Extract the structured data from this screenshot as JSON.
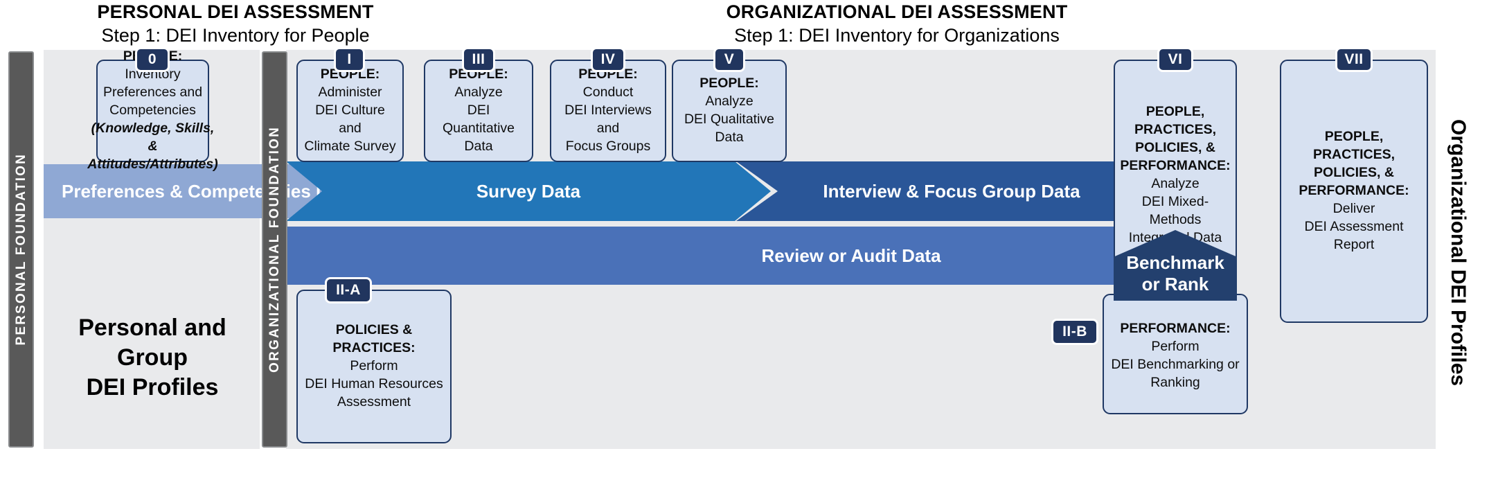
{
  "headers": {
    "personal": {
      "line1": "PERSONAL DEI ASSESSMENT",
      "line2": "Step 1: DEI Inventory for People"
    },
    "organizational": {
      "line1": "ORGANIZATIONAL DEI ASSESSMENT",
      "line2": "Step 1: DEI Inventory for Organizations"
    }
  },
  "foundations": {
    "personal": "PERSONAL FOUNDATION",
    "organizational": "ORGANIZATIONAL FOUNDATION"
  },
  "right_label": "Organizational DEI Profiles",
  "personal_summary": "Personal and\nGroup\nDEI Profiles",
  "cards": [
    {
      "badge": "0",
      "heading": "PEOPLE:",
      "lines": [
        "Inventory",
        "Preferences and",
        "Competencies"
      ],
      "italic_lines": [
        "(Knowledge, Skills, &",
        "Attitudes/Attributes)"
      ]
    },
    {
      "badge": "I",
      "heading": "PEOPLE:",
      "lines": [
        "Administer",
        "DEI Culture and",
        "Climate Survey"
      ],
      "italic_lines": []
    },
    {
      "badge": "III",
      "heading": "PEOPLE:",
      "lines": [
        "Analyze",
        "DEI Quantitative",
        "Data"
      ],
      "italic_lines": []
    },
    {
      "badge": "IV",
      "heading": "PEOPLE:",
      "lines": [
        "Conduct",
        "DEI Interviews and",
        "Focus Groups"
      ],
      "italic_lines": []
    },
    {
      "badge": "V",
      "heading": "PEOPLE:",
      "lines": [
        "Analyze",
        "DEI Qualitative",
        "Data"
      ],
      "italic_lines": []
    },
    {
      "badge": "VI",
      "heading": "PEOPLE,\nPRACTICES,\nPOLICIES, &\nPERFORMANCE:",
      "lines": [
        "Analyze",
        "DEI Mixed-Methods",
        "Integrated Data"
      ],
      "italic_lines": []
    },
    {
      "badge": "VII",
      "heading": "PEOPLE,\nPRACTICES,\nPOLICIES, &\nPERFORMANCE:",
      "lines": [
        "Deliver",
        "DEI Assessment",
        "Report"
      ],
      "italic_lines": []
    },
    {
      "badge": "II-A",
      "heading": "POLICIES & PRACTICES:",
      "lines": [
        "Perform",
        "DEI Human Resources",
        "Assessment"
      ],
      "italic_lines": []
    },
    {
      "badge": "II-B",
      "heading": "PERFORMANCE:",
      "lines": [
        "Perform",
        "DEI Benchmarking or",
        "Ranking"
      ],
      "italic_lines": []
    }
  ],
  "bands": [
    {
      "label": "Preferences & Competencies Data",
      "color": "#8fa8d4"
    },
    {
      "label": "Survey Data",
      "color": "#2276b8"
    },
    {
      "label": "Interview & Focus Group Data",
      "color": "#2a5698"
    },
    {
      "label": "Review or Audit Data",
      "color": "#4a71b8"
    }
  ],
  "benchmark": {
    "label": "Benchmark\nor Rank",
    "color": "#23406e"
  },
  "colors": {
    "panel_bg": "#e9eaec",
    "card_bg": "#d7e1f1",
    "card_border": "#1f3864",
    "badge_bg": "#21355e",
    "foundation_bg": "#595959"
  }
}
